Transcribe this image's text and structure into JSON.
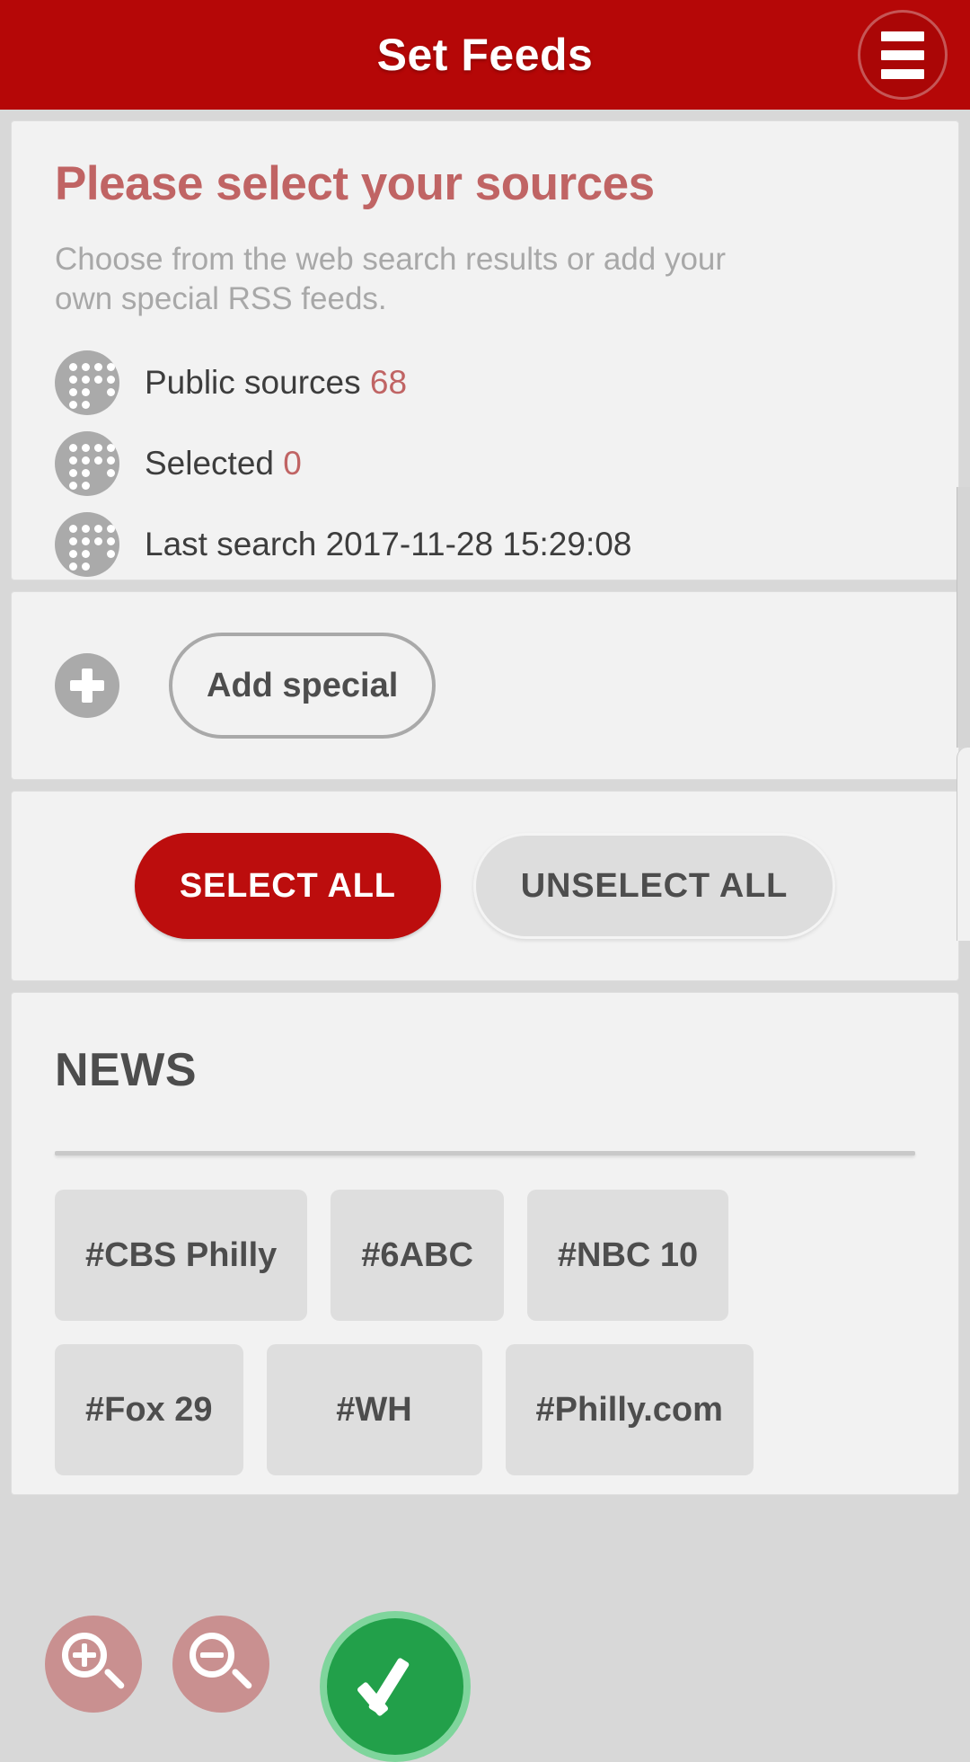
{
  "header": {
    "title": "Set Feeds",
    "menu_icon": "hamburger-menu-icon"
  },
  "intro": {
    "title": "Please select your sources",
    "subtitle": "Choose from the web search results or add your own special RSS feeds.",
    "rows": [
      {
        "label": "Public sources",
        "value": "68",
        "icon": "dot-grid-icon"
      },
      {
        "label": "Selected",
        "value": "0",
        "icon": "dot-grid-icon"
      },
      {
        "label": "Last search",
        "value": "2017-11-28 15:29:08",
        "icon": "dot-grid-icon"
      }
    ]
  },
  "add_special": {
    "plus_icon": "plus-icon",
    "label": "Add special"
  },
  "actions": {
    "select_all": "SELECT ALL",
    "unselect_all": "UNSELECT ALL"
  },
  "news": {
    "title": "NEWS",
    "chips_row_1": [
      "#CBS Philly",
      "#6ABC",
      "#NBC 10"
    ],
    "chips_row_2": [
      "#Fox 29",
      "#WH",
      "#Philly.com"
    ]
  },
  "overlays": {
    "zoom_in_icon": "magnifier-plus-icon",
    "zoom_out_icon": "magnifier-minus-icon",
    "confirm_icon": "checkmark-icon"
  },
  "colors": {
    "brand_red": "#b50707",
    "button_red": "#bc0d0d",
    "muted_red": "#c06464",
    "confirm_green": "#22a04a",
    "card_bg": "#f2f2f2",
    "page_bg": "#d8d8d8"
  }
}
